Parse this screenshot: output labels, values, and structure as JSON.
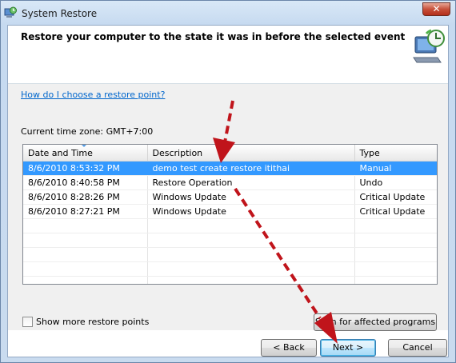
{
  "window": {
    "title": "System Restore",
    "close_label": "✕"
  },
  "header": {
    "heading": "Restore your computer to the state it was in before the selected event"
  },
  "help_link": "How do I choose a restore point?",
  "timezone": "Current time zone: GMT+7:00",
  "table": {
    "columns": [
      "Date and Time",
      "Description",
      "Type"
    ],
    "rows": [
      {
        "date": "8/6/2010 8:53:32 PM",
        "description": "demo test create restore itithai",
        "type": "Manual",
        "selected": true
      },
      {
        "date": "8/6/2010 8:40:58 PM",
        "description": "Restore Operation",
        "type": "Undo",
        "selected": false
      },
      {
        "date": "8/6/2010 8:28:26 PM",
        "description": "Windows Update",
        "type": "Critical Update",
        "selected": false
      },
      {
        "date": "8/6/2010 8:27:21 PM",
        "description": "Windows Update",
        "type": "Critical Update",
        "selected": false
      }
    ]
  },
  "show_more": {
    "label": "Show more restore points",
    "checked": false
  },
  "buttons": {
    "scan": "Scan for affected programs",
    "back": "< Back",
    "next": "Next >",
    "cancel": "Cancel"
  },
  "colors": {
    "selection": "#3399ff",
    "link": "#0066cc",
    "annotation_arrow": "#c0141b"
  },
  "icons": {
    "app": "system-restore-icon",
    "header": "system-restore-monitor-clock-icon"
  }
}
